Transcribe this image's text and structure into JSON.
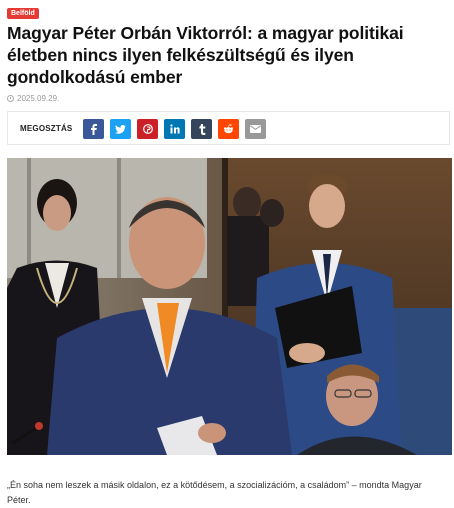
{
  "article": {
    "category": "Belföld",
    "title": "Magyar Péter Orbán Viktorról: a magyar politikai életben nincs ilyen felkészültségű és ilyen gondolkodású ember",
    "date": "2025.09.29.",
    "caption": "„Én soha nem leszek a másik oldalon, ez a kötődésem, a szocializációm, a családom” – mondta Magyar Péter."
  },
  "share": {
    "label": "MEGOSZTÁS",
    "buttons": [
      {
        "name": "facebook",
        "icon": "facebook-icon",
        "glyph": "f",
        "color": "#3b5998"
      },
      {
        "name": "twitter",
        "icon": "twitter-icon",
        "glyph": "t",
        "color": "#1da1f2"
      },
      {
        "name": "pinterest",
        "icon": "pinterest-icon",
        "glyph": "p",
        "color": "#cb2027"
      },
      {
        "name": "linkedin",
        "icon": "linkedin-icon",
        "glyph": "in",
        "color": "#0077b5"
      },
      {
        "name": "tumblr",
        "icon": "tumblr-icon",
        "glyph": "t",
        "color": "#35465c"
      },
      {
        "name": "reddit",
        "icon": "reddit-icon",
        "glyph": "r",
        "color": "#ff4500"
      },
      {
        "name": "email",
        "icon": "email-icon",
        "glyph": "✉",
        "color": "#999999"
      }
    ]
  },
  "colors": {
    "accent": "#e53935"
  }
}
